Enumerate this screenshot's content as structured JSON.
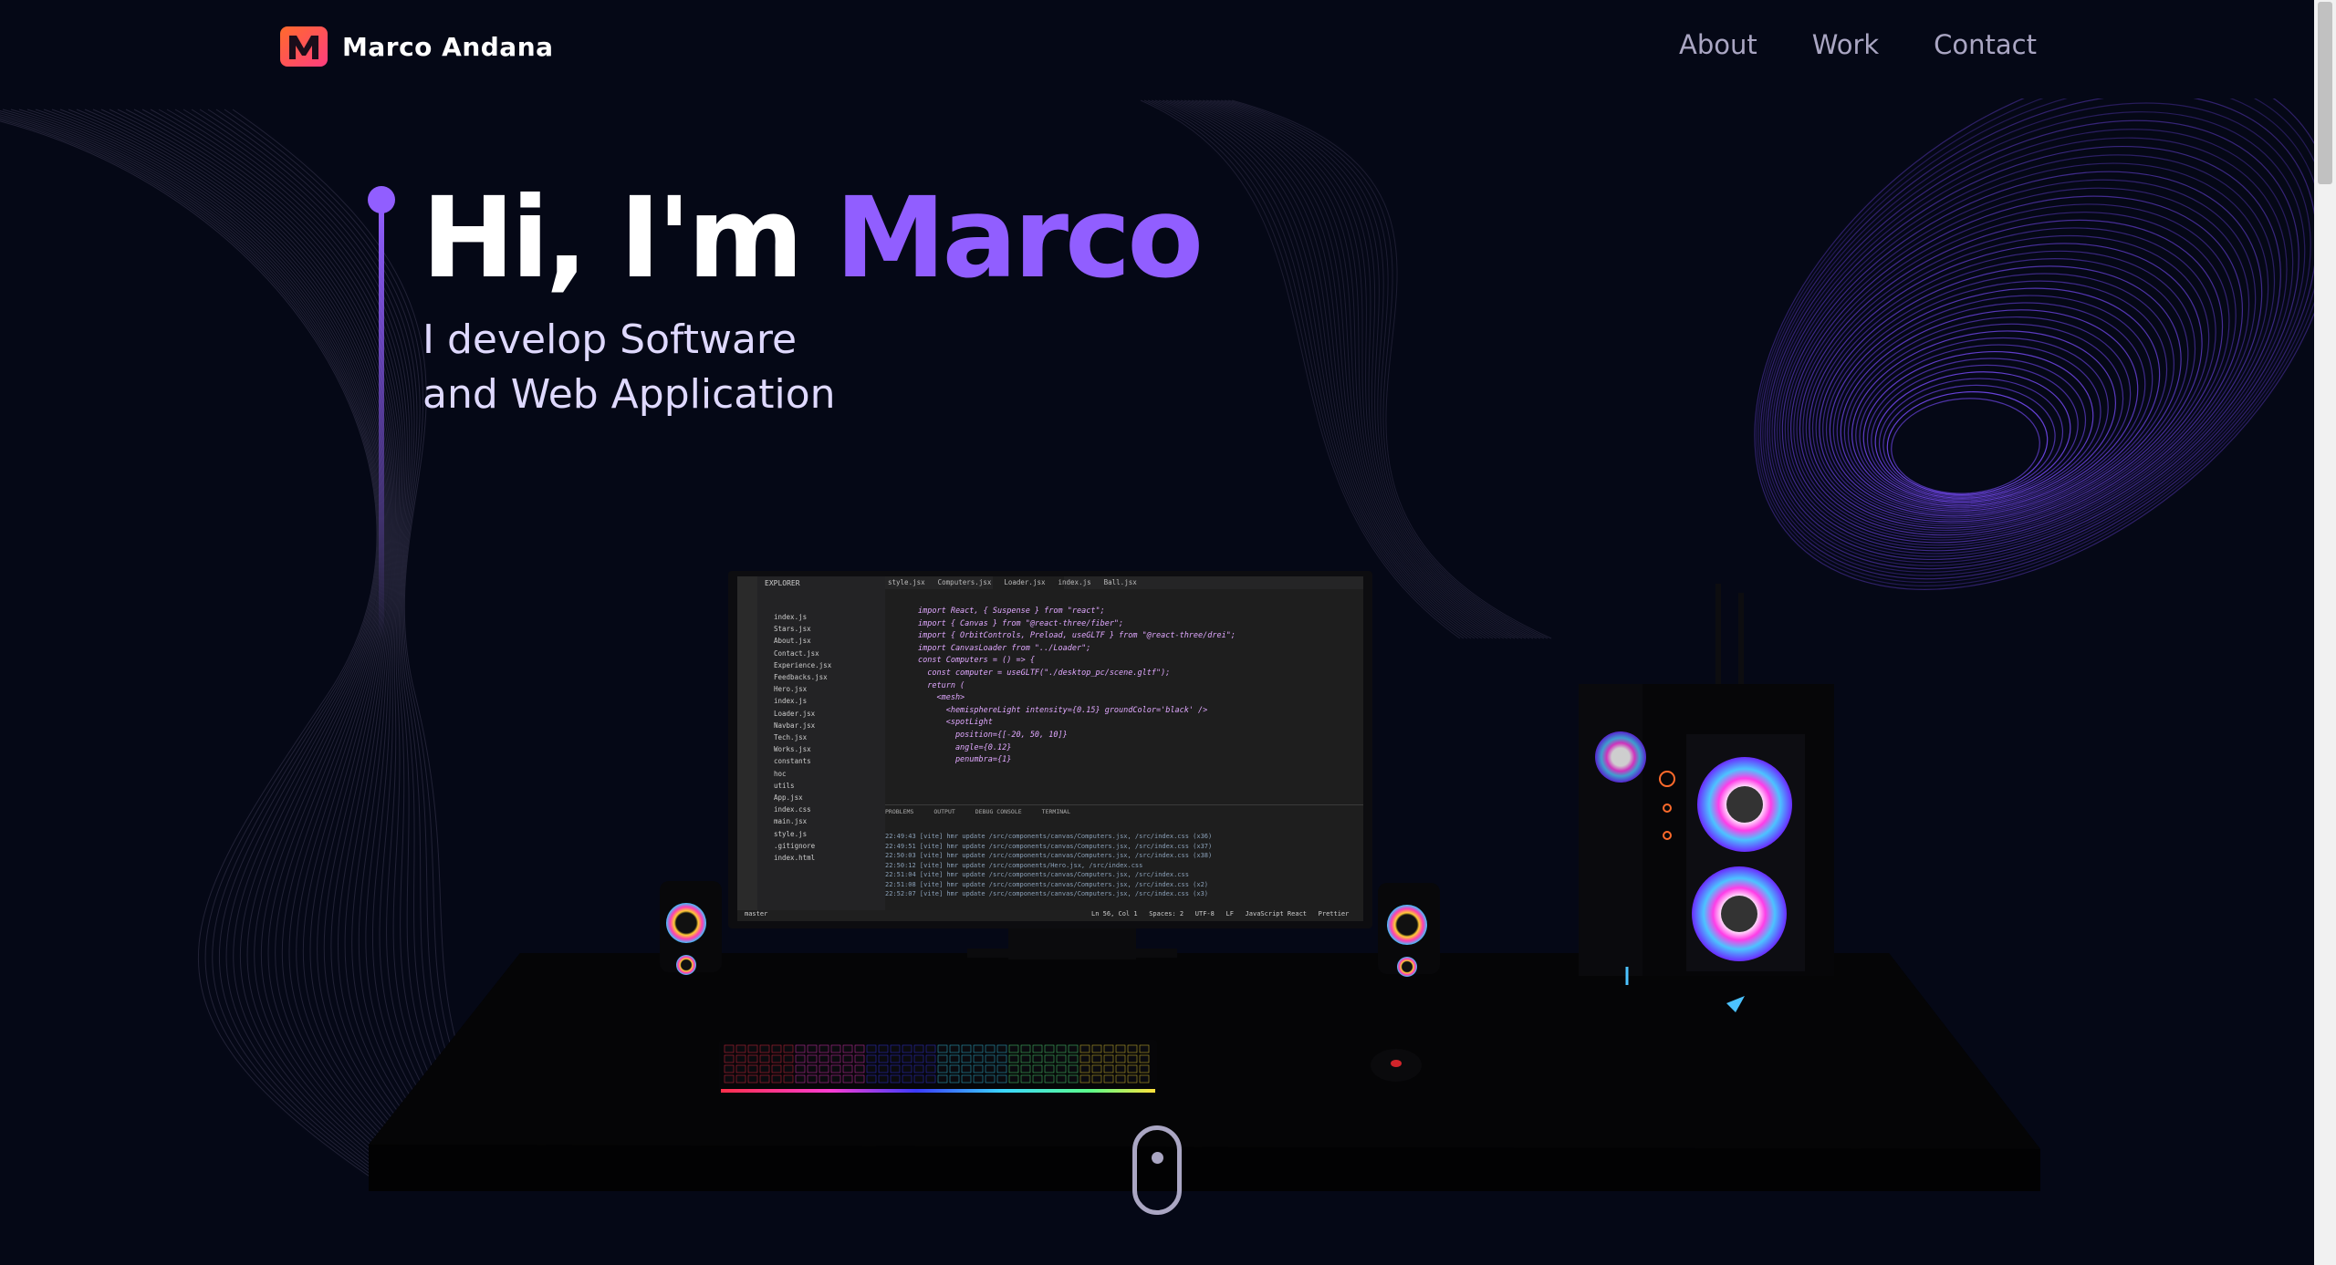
{
  "brand": {
    "name": "Marco Andana",
    "logo_letter": "M"
  },
  "nav": {
    "links": [
      "About",
      "Work",
      "Contact"
    ]
  },
  "hero": {
    "greeting": "Hi, I'm ",
    "name": "Marco",
    "subtitle_line1": "I develop Software",
    "subtitle_line2": "and Web Application"
  },
  "editor": {
    "tabs": [
      "style.jsx",
      "Computers.jsx",
      "Loader.jsx",
      "index.js",
      "Ball.jsx"
    ],
    "sidebar_header": "EXPLORER",
    "files": [
      "index.js",
      "Stars.jsx",
      "About.jsx",
      "Contact.jsx",
      "Experience.jsx",
      "Feedbacks.jsx",
      "Hero.jsx",
      "index.js",
      "Loader.jsx",
      "Navbar.jsx",
      "Tech.jsx",
      "Works.jsx",
      "constants",
      "hoc",
      "utils",
      "App.jsx",
      "index.css",
      "main.jsx",
      "style.js",
      ".gitignore",
      "index.html"
    ],
    "code_lines": [
      "import React, { Suspense } from \"react\";",
      "import { Canvas } from \"@react-three/fiber\";",
      "import { OrbitControls, Preload, useGLTF } from \"@react-three/drei\";",
      "",
      "import CanvasLoader from \"../Loader\";",
      "",
      "const Computers = () => {",
      "  const computer = useGLTF(\"./desktop_pc/scene.gltf\");",
      "",
      "  return (",
      "    <mesh>",
      "      <hemisphereLight intensity={0.15} groundColor='black' />",
      "      <spotLight",
      "        position={[-20, 50, 10]}",
      "        angle={0.12}",
      "        penumbra={1}"
    ],
    "panel_tabs": [
      "PROBLEMS",
      "OUTPUT",
      "DEBUG CONSOLE",
      "TERMINAL"
    ],
    "terminal_lines": [
      "22:49:43 [vite] hmr update /src/components/canvas/Computers.jsx, /src/index.css (x36)",
      "22:49:51 [vite] hmr update /src/components/canvas/Computers.jsx, /src/index.css (x37)",
      "22:50:03 [vite] hmr update /src/components/canvas/Computers.jsx, /src/index.css (x38)",
      "22:50:12 [vite] hmr update /src/components/Hero.jsx, /src/index.css",
      "22:51:04 [vite] hmr update /src/components/canvas/Computers.jsx, /src/index.css",
      "22:51:08 [vite] hmr update /src/components/canvas/Computers.jsx, /src/index.css (x2)",
      "22:52:07 [vite] hmr update /src/components/canvas/Computers.jsx, /src/index.css (x3)"
    ],
    "status_left": "master",
    "status_right": "Ln 56, Col 1   Spaces: 2   UTF-8   LF   JavaScript React   Prettier"
  },
  "colors": {
    "background": "#050816",
    "accent": "#915eff",
    "secondary": "#aaa6c3"
  }
}
